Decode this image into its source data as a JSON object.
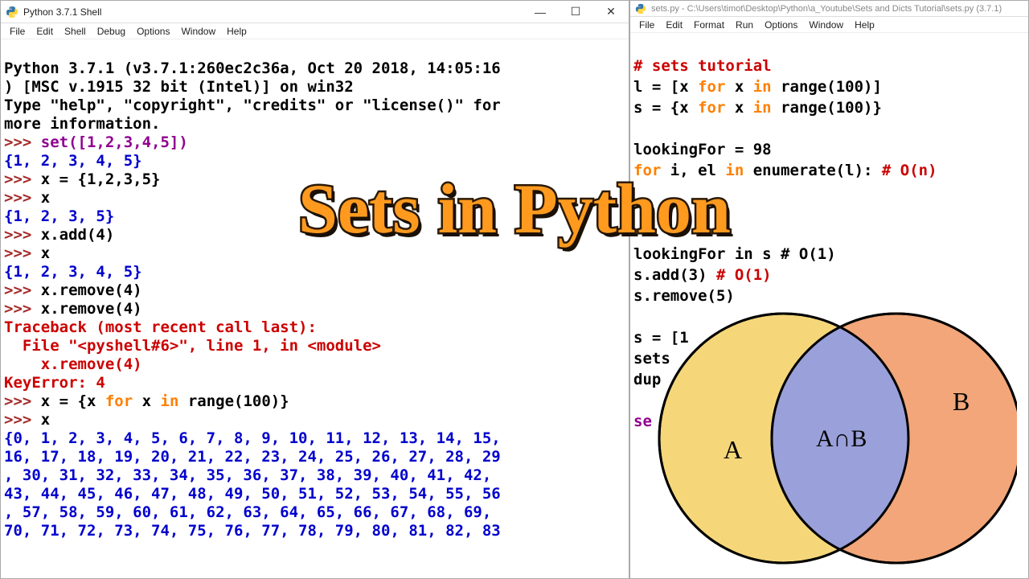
{
  "left": {
    "title": "Python 3.7.1 Shell",
    "menu": [
      "File",
      "Edit",
      "Shell",
      "Debug",
      "Options",
      "Window",
      "Help"
    ],
    "banner1": "Python 3.7.1 (v3.7.1:260ec2c36a, Oct 20 2018, 14:05:16",
    "banner2": ") [MSC v.1915 32 bit (Intel)] on win32",
    "banner3": "Type \"help\", \"copyright\", \"credits\" or \"license()\" for",
    "banner4": "more information.",
    "l1_in": "set([1,2,3,4,5])",
    "l1_out": "{1, 2, 3, 4, 5}",
    "l2_in": "x = {1,2,3,5}",
    "l3_in": "x",
    "l3_out": "{1, 2, 3, 5}",
    "l4_in": "x.add(4)",
    "l5_in": "x",
    "l5_out": "{1, 2, 3, 4, 5}",
    "l6_in": "x.remove(4)",
    "l7_in": "x.remove(4)",
    "tb1": "Traceback (most recent call last):",
    "tb2": "  File \"<pyshell#6>\", line 1, in <module>",
    "tb3": "    x.remove(4)",
    "tb4": "KeyError: 4",
    "l8_pre": "x = {x ",
    "l8_kw1": "for",
    "l8_mid": " x ",
    "l8_kw2": "in",
    "l8_end": " range(100)}",
    "l9_in": "x",
    "big0": "{0, 1, 2, 3, 4, 5, 6, 7, 8, 9, 10, 11, 12, 13, 14, 15,",
    "big1": "16, 17, 18, 19, 20, 21, 22, 23, 24, 25, 26, 27, 28, 29",
    "big2": ", 30, 31, 32, 33, 34, 35, 36, 37, 38, 39, 40, 41, 42, ",
    "big3": "43, 44, 45, 46, 47, 48, 49, 50, 51, 52, 53, 54, 55, 56",
    "big4": ", 57, 58, 59, 60, 61, 62, 63, 64, 65, 66, 67, 68, 69, ",
    "big5": "70, 71, 72, 73, 74, 75, 76, 77, 78, 79, 80, 81, 82, 83"
  },
  "right": {
    "title": "sets.py - C:\\Users\\timot\\Desktop\\Python\\a_Youtube\\Sets and Dicts Tutorial\\sets.py (3.7.1)",
    "menu": [
      "File",
      "Edit",
      "Format",
      "Run",
      "Options",
      "Window",
      "Help"
    ],
    "c_comment": "# sets tutorial",
    "c_l1a": "l = [x ",
    "c_l1b": " x ",
    "c_l1c": " range(100)]",
    "c_l2a": "s = {x ",
    "c_l2b": " x ",
    "c_l2c": " range(100)}",
    "c_l3": "lookingFor = 98",
    "c_l4a": " i, el ",
    "c_l4b": " enumerate(l): ",
    "c_l4c": "# O(n)",
    "c_l5": "lookingFor in s # O(1)",
    "c_l6": "s.add(3) ",
    "c_l6c": "# O(1)",
    "c_l7": "s.remove(5)",
    "c_l8": "s = [1",
    "c_l9": "sets",
    "c_l10": "dup",
    "c_l11": "se"
  },
  "overlay": {
    "title": "Sets in Python"
  },
  "venn": {
    "A": "A",
    "B": "B",
    "AB": "A∩B",
    "note": ""
  },
  "winbtns": {
    "min": "—",
    "max": "☐",
    "close": "✕"
  },
  "prompt": ">>> ",
  "kw_for": "for",
  "kw_in": "in"
}
